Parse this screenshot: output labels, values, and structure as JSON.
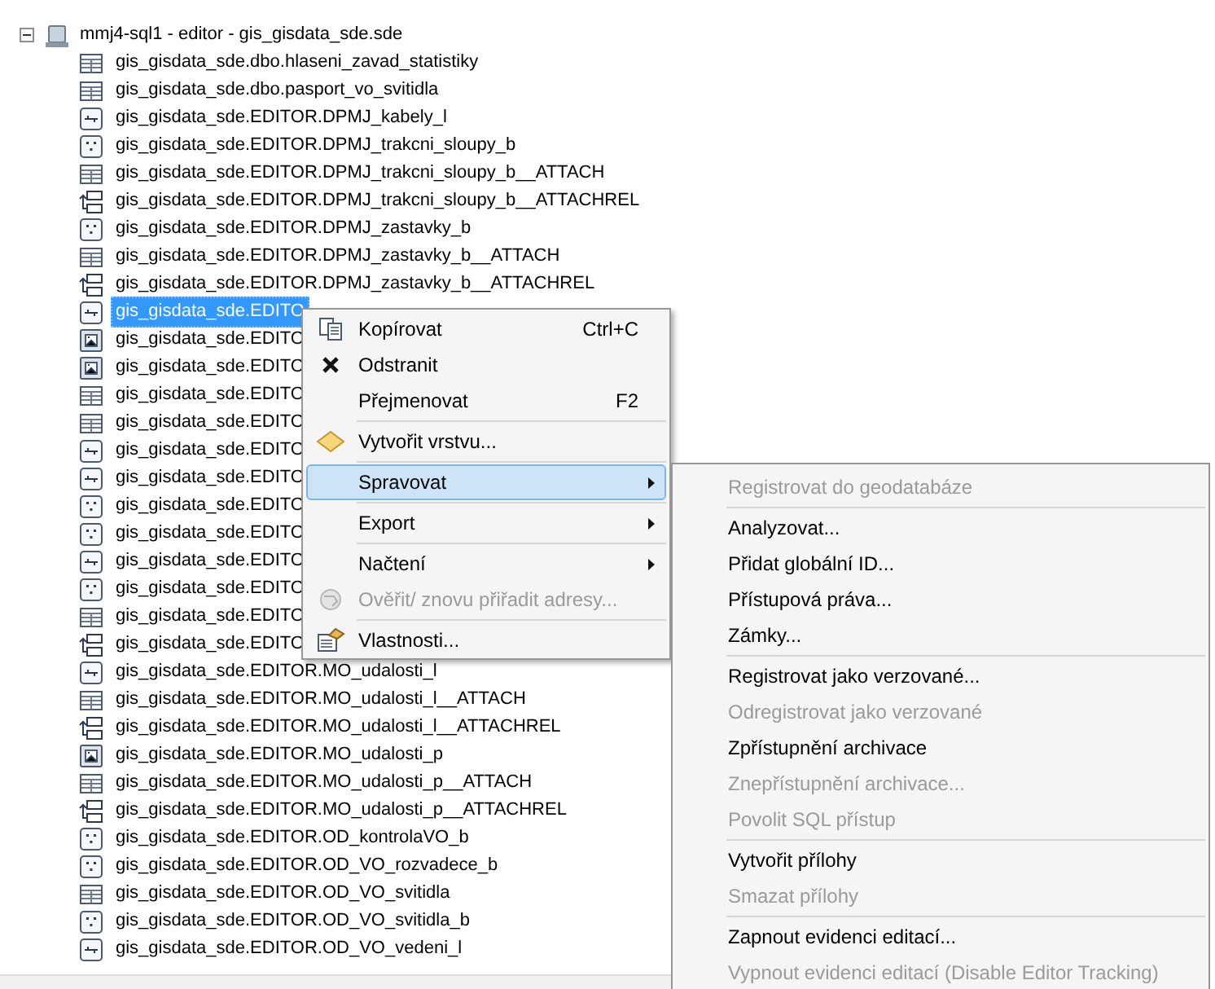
{
  "tree": {
    "root": {
      "label": "mmj4-sql1 - editor - gis_gisdata_sde.sde",
      "expanded": true,
      "children": [
        {
          "label": "gis_gisdata_sde.dbo.hlaseni_zavad_statistiky",
          "kind": "table",
          "selected": false
        },
        {
          "label": "gis_gisdata_sde.dbo.pasport_vo_svitidla",
          "kind": "table",
          "selected": false
        },
        {
          "label": "gis_gisdata_sde.EDITOR.DPMJ_kabely_l",
          "kind": "line",
          "selected": false
        },
        {
          "label": "gis_gisdata_sde.EDITOR.DPMJ_trakcni_sloupy_b",
          "kind": "point",
          "selected": false
        },
        {
          "label": "gis_gisdata_sde.EDITOR.DPMJ_trakcni_sloupy_b__ATTACH",
          "kind": "table",
          "selected": false
        },
        {
          "label": "gis_gisdata_sde.EDITOR.DPMJ_trakcni_sloupy_b__ATTACHREL",
          "kind": "relationship",
          "selected": false
        },
        {
          "label": "gis_gisdata_sde.EDITOR.DPMJ_zastavky_b",
          "kind": "point",
          "selected": false
        },
        {
          "label": "gis_gisdata_sde.EDITOR.DPMJ_zastavky_b__ATTACH",
          "kind": "table",
          "selected": false
        },
        {
          "label": "gis_gisdata_sde.EDITOR.DPMJ_zastavky_b__ATTACHREL",
          "kind": "relationship",
          "selected": false
        },
        {
          "label": "gis_gisdata_sde.EDITO",
          "kind": "line",
          "selected": true
        },
        {
          "label": "gis_gisdata_sde.EDITO",
          "kind": "raster",
          "selected": false
        },
        {
          "label": "gis_gisdata_sde.EDITO",
          "kind": "raster",
          "selected": false
        },
        {
          "label": "gis_gisdata_sde.EDITO",
          "kind": "table",
          "selected": false
        },
        {
          "label": "gis_gisdata_sde.EDITO",
          "kind": "table",
          "selected": false
        },
        {
          "label": "gis_gisdata_sde.EDITO",
          "kind": "line",
          "selected": false
        },
        {
          "label": "gis_gisdata_sde.EDITO",
          "kind": "line",
          "selected": false
        },
        {
          "label": "gis_gisdata_sde.EDITO",
          "kind": "point",
          "selected": false
        },
        {
          "label": "gis_gisdata_sde.EDITO",
          "kind": "point",
          "selected": false
        },
        {
          "label": "gis_gisdata_sde.EDITO",
          "kind": "line",
          "selected": false
        },
        {
          "label": "gis_gisdata_sde.EDITO",
          "kind": "point",
          "selected": false
        },
        {
          "label": "gis_gisdata_sde.EDITO",
          "kind": "table",
          "selected": false
        },
        {
          "label": "gis_gisdata_sde.EDITO",
          "kind": "relationship",
          "selected": false
        },
        {
          "label": "gis_gisdata_sde.EDITOR.MO_udalosti_l",
          "kind": "line",
          "selected": false
        },
        {
          "label": "gis_gisdata_sde.EDITOR.MO_udalosti_l__ATTACH",
          "kind": "table",
          "selected": false
        },
        {
          "label": "gis_gisdata_sde.EDITOR.MO_udalosti_l__ATTACHREL",
          "kind": "relationship",
          "selected": false
        },
        {
          "label": "gis_gisdata_sde.EDITOR.MO_udalosti_p",
          "kind": "raster",
          "selected": false
        },
        {
          "label": "gis_gisdata_sde.EDITOR.MO_udalosti_p__ATTACH",
          "kind": "table",
          "selected": false
        },
        {
          "label": "gis_gisdata_sde.EDITOR.MO_udalosti_p__ATTACHREL",
          "kind": "relationship",
          "selected": false
        },
        {
          "label": "gis_gisdata_sde.EDITOR.OD_kontrolaVO_b",
          "kind": "point",
          "selected": false
        },
        {
          "label": "gis_gisdata_sde.EDITOR.OD_VO_rozvadece_b",
          "kind": "point",
          "selected": false
        },
        {
          "label": "gis_gisdata_sde.EDITOR.OD_VO_svitidla",
          "kind": "table",
          "selected": false
        },
        {
          "label": "gis_gisdata_sde.EDITOR.OD_VO_svitidla_b",
          "kind": "point",
          "selected": false
        },
        {
          "label": "gis_gisdata_sde.EDITOR.OD_VO_vedeni_l",
          "kind": "line",
          "selected": false
        }
      ]
    }
  },
  "context_menu": {
    "items": [
      {
        "kind": "item",
        "label": "Kopírovat",
        "shortcut": "Ctrl+C",
        "disabled": false,
        "selected": false,
        "has_submenu": false
      },
      {
        "kind": "item",
        "label": "Odstranit",
        "disabled": false,
        "selected": false,
        "has_submenu": false
      },
      {
        "kind": "item",
        "label": "Přejmenovat",
        "shortcut": "F2",
        "disabled": false,
        "selected": false,
        "has_submenu": false
      },
      {
        "kind": "separator"
      },
      {
        "kind": "item",
        "label": "Vytvořit vrstvu...",
        "disabled": false,
        "selected": false,
        "has_submenu": false
      },
      {
        "kind": "separator"
      },
      {
        "kind": "item",
        "label": "Spravovat",
        "disabled": false,
        "selected": true,
        "has_submenu": true
      },
      {
        "kind": "separator"
      },
      {
        "kind": "item",
        "label": "Export",
        "disabled": false,
        "selected": false,
        "has_submenu": true
      },
      {
        "kind": "separator"
      },
      {
        "kind": "item",
        "label": "Načtení",
        "disabled": false,
        "selected": false,
        "has_submenu": true
      },
      {
        "kind": "item",
        "label": "Ověřit/ znovu přiřadit adresy...",
        "disabled": true,
        "selected": false,
        "has_submenu": false
      },
      {
        "kind": "separator"
      },
      {
        "kind": "item",
        "label": "Vlastnosti...",
        "disabled": false,
        "selected": false,
        "has_submenu": false
      }
    ]
  },
  "submenu": {
    "items": [
      {
        "kind": "item",
        "label": "Registrovat do geodatabáze",
        "disabled": true
      },
      {
        "kind": "separator"
      },
      {
        "kind": "item",
        "label": "Analyzovat...",
        "disabled": false
      },
      {
        "kind": "item",
        "label": "Přidat globální ID...",
        "disabled": false
      },
      {
        "kind": "item",
        "label": "Přístupová práva...",
        "disabled": false
      },
      {
        "kind": "item",
        "label": "Zámky...",
        "disabled": false
      },
      {
        "kind": "separator"
      },
      {
        "kind": "item",
        "label": "Registrovat jako verzované...",
        "disabled": false
      },
      {
        "kind": "item",
        "label": "Odregistrovat jako verzované",
        "disabled": true
      },
      {
        "kind": "item",
        "label": "Zpřístupnění archivace",
        "disabled": false
      },
      {
        "kind": "item",
        "label": "Znepřístupnění archivace...",
        "disabled": true
      },
      {
        "kind": "item",
        "label": "Povolit SQL přístup",
        "disabled": true
      },
      {
        "kind": "separator"
      },
      {
        "kind": "item",
        "label": "Vytvořit přílohy",
        "disabled": false
      },
      {
        "kind": "item",
        "label": "Smazat přílohy",
        "disabled": true
      },
      {
        "kind": "separator"
      },
      {
        "kind": "item",
        "label": "Zapnout evidenci editací...",
        "disabled": false
      },
      {
        "kind": "item",
        "label": "Vypnout evidenci editací (Disable Editor Tracking)",
        "disabled": true
      }
    ]
  }
}
